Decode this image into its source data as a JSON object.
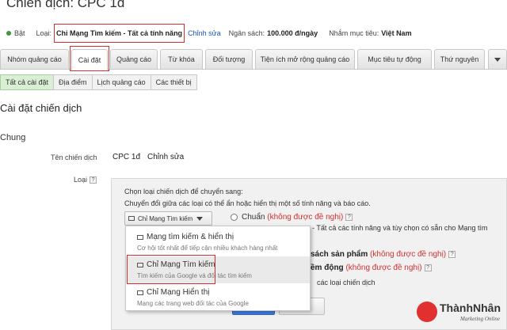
{
  "title": "Chiến dịch: CPC 1đ",
  "status": {
    "label": "Bật",
    "color": "#3b9a3b"
  },
  "info": {
    "type_label": "Loại:",
    "type_value": "Chỉ Mạng Tìm kiếm - Tất cả tính năng",
    "edit_link": "Chỉnh sửa",
    "budget_label": "Ngân sách:",
    "budget_value": "100.000 đ/ngày",
    "target_label": "Nhắm mục tiêu:",
    "target_value": "Việt Nam"
  },
  "tabs": [
    {
      "label": "Nhóm quảng cáo",
      "active": false
    },
    {
      "label": "Cài đặt",
      "active": true
    },
    {
      "label": "Quảng cáo",
      "active": false
    },
    {
      "label": "Từ khóa",
      "active": false
    },
    {
      "label": "Đối tượng",
      "active": false
    },
    {
      "label": "Tiện ích mở rộng quảng cáo",
      "active": false
    },
    {
      "label": "Mục tiêu tự động",
      "active": false
    },
    {
      "label": "Thứ nguyên",
      "active": false
    }
  ],
  "subtabs": [
    {
      "label": "Tất cả cài đặt",
      "active": true
    },
    {
      "label": "Địa điểm",
      "active": false
    },
    {
      "label": "Lịch quảng cáo",
      "active": false
    },
    {
      "label": "Các thiết bị",
      "active": false
    }
  ],
  "heading": "Cài đặt chiến dịch",
  "section": "Chung",
  "fields": {
    "name_label": "Tên chiến dịch",
    "name_value": "CPC 1đ",
    "name_edit": "Chỉnh sửa",
    "type_label": "Loại",
    "help_icon": "?"
  },
  "panel": {
    "prompt": "Chọn loại chiến dịch để chuyển sang:",
    "desc": "Chuyển đổi giữa các loại có thể ẩn hoặc hiển thị một số tính năng và báo cáo.",
    "dropdown_value": "Chỉ Mạng Tìm kiếm",
    "option_standard": "Chuẩn",
    "not_recommended": "(không được đề nghị)",
    "option_all_features": "- Tất cả các tính năng và tùy chọn có sẵn cho Mạng tìm",
    "option_products_tail": "sách sản phẩm",
    "not_recommended_2": "(không được đề nghị)",
    "option_dynamic_tail": "ềm động",
    "not_recommended_3": "(không được đề nghị)",
    "about_link": "các loại chiến dịch"
  },
  "menu": [
    {
      "title": "Mạng tìm kiếm & hiển thị",
      "desc": "Cơ hội tốt nhất để tiếp cận nhiều khách hàng nhất"
    },
    {
      "title": "Chỉ Mạng Tìm kiếm",
      "desc": "Tìm kiếm của Google và đối tác tìm kiếm"
    },
    {
      "title": "Chỉ Mạng Hiển thị",
      "desc": "Mạng các trang web đối tác của Google"
    }
  ],
  "logo": {
    "brand": "ThànhNhân",
    "tagline": "Marketing Online"
  }
}
